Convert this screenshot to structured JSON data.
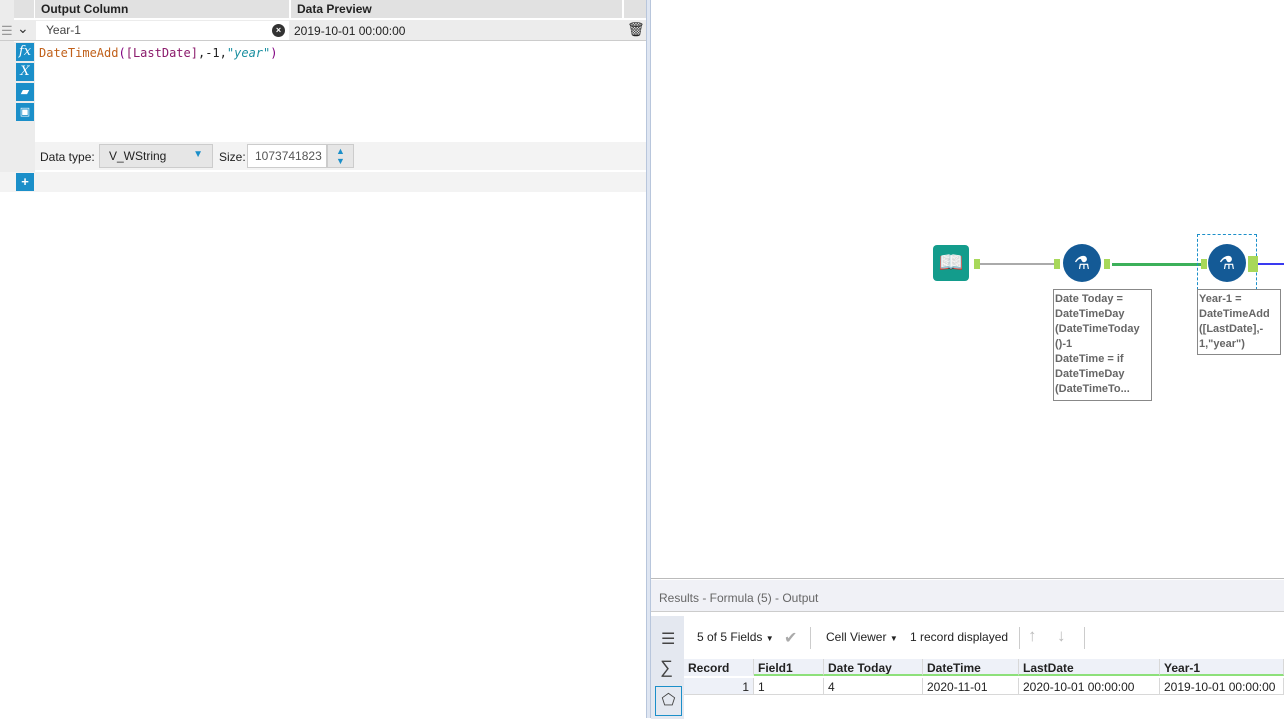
{
  "formula_panel": {
    "col_output": "Output Column",
    "col_preview": "Data Preview",
    "field_value": "Year-1",
    "preview_value": "2019-10-01 00:00:00",
    "expression": {
      "fn": "DateTimeAdd",
      "open": "(",
      "field": "[LastDate]",
      "comma1": ",",
      "num": "-1",
      "comma2": ",",
      "str": "\"year\"",
      "close": ")"
    },
    "data_type_label": "Data type:",
    "data_type_value": "V_WString",
    "size_label": "Size:",
    "size_value": "1073741823",
    "icons": [
      "fx-icon",
      "variable-icon",
      "open-folder-icon",
      "save-icon"
    ]
  },
  "canvas": {
    "tool1_annotation": [
      "Date Today =",
      "DateTimeDay",
      "(DateTimeToday",
      "()-1",
      "DateTime = if",
      "DateTimeDay",
      "(DateTimeTo..."
    ],
    "tool2_annotation": [
      "Year-1 =",
      "DateTimeAdd",
      "([LastDate],-",
      "1,\"year\")"
    ],
    "colors": {
      "input_tool": "#139c8c",
      "formula_tool": "#145a96",
      "connection_gray": "#aaaaaa",
      "connection_green": "#3cb05a",
      "connection_blue": "#3a3af0"
    }
  },
  "results": {
    "title": "Results - Formula (5) - Output",
    "fields_label": "5 of 5 Fields",
    "viewer_label": "Cell Viewer",
    "records_label": "1 record displayed",
    "columns": [
      "Record",
      "Field1",
      "Date Today",
      "DateTime",
      "LastDate",
      "Year-1"
    ],
    "rows": [
      [
        "1",
        "1",
        "4",
        "2020-11-01",
        "2020-10-01 00:00:00",
        "2019-10-01 00:00:00"
      ]
    ]
  }
}
